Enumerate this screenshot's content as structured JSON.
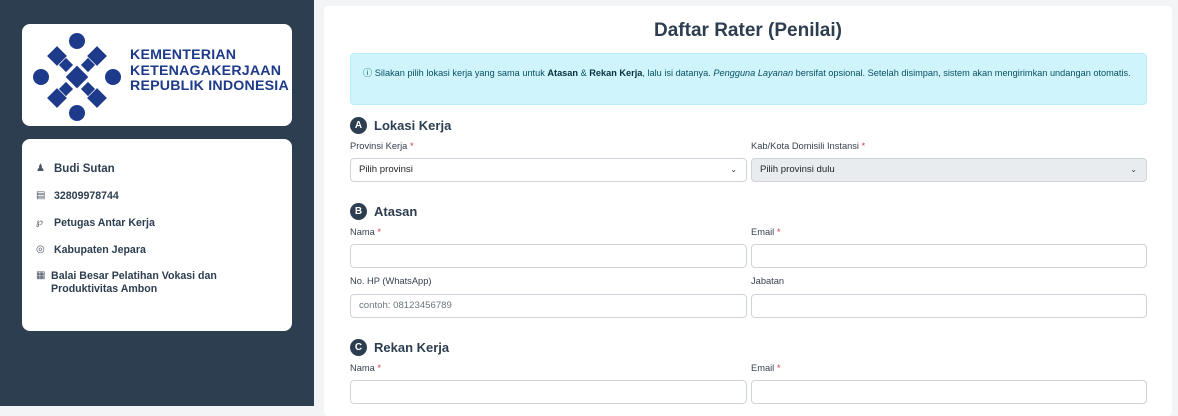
{
  "sidebar": {
    "logo_lines": [
      "KEMENTERIAN",
      "KETENAGAKERJAAN",
      "REPUBLIK INDONESIA"
    ],
    "user": {
      "name": "Budi Sutan",
      "id": "32809978744",
      "role": "Petugas Antar Kerja",
      "location": "Kabupaten Jepara",
      "institution": "Balai Besar Pelatihan Vokasi dan Produktivitas Ambon"
    }
  },
  "main": {
    "title": "Daftar Rater (Penilai)",
    "info": {
      "part1": "Silakan pilih lokasi kerja yang sama untuk ",
      "b1": "Atasan",
      "part2": " & ",
      "b2": "Rekan Kerja",
      "part3": ", lalu isi datanya. ",
      "i1": "Pengguna Layanan",
      "part4": " bersifat opsional. Setelah disimpan, sistem akan mengirimkan undangan otomatis."
    },
    "section_a": {
      "badge": "A",
      "title": "Lokasi Kerja",
      "provinsi_label": "Provinsi Kerja",
      "provinsi_value": "Pilih provinsi",
      "kab_label": "Kab/Kota Domisili Instansi",
      "kab_value": "Pilih provinsi dulu"
    },
    "section_b": {
      "badge": "B",
      "title": "Atasan",
      "nama_label": "Nama",
      "email_label": "Email",
      "hp_label": "No. HP (WhatsApp)",
      "hp_placeholder": "contoh: 08123456789",
      "jabatan_label": "Jabatan"
    },
    "section_c": {
      "badge": "C",
      "title": "Rekan Kerja",
      "nama_label": "Nama",
      "email_label": "Email"
    },
    "required_mark": "*"
  }
}
